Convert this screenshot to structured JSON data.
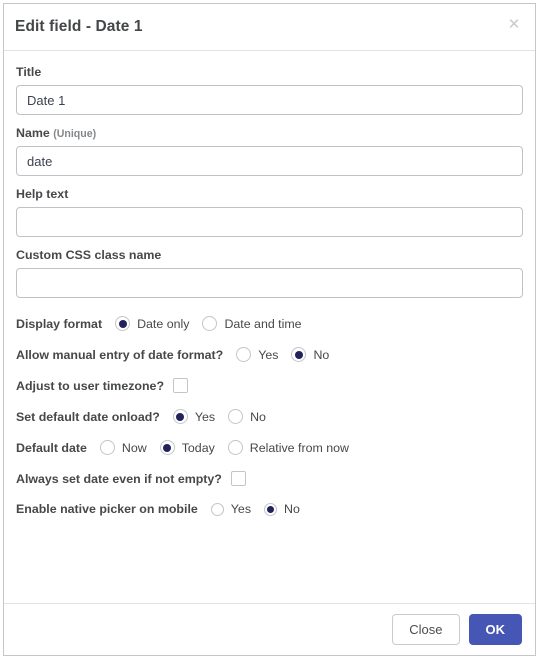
{
  "dialog": {
    "title": "Edit field - Date 1",
    "close_icon": "close-icon"
  },
  "fields": {
    "title": {
      "label": "Title",
      "value": "Date 1",
      "placeholder": ""
    },
    "name": {
      "label": "Name",
      "label_suffix": "(Unique)",
      "value": "date",
      "placeholder": ""
    },
    "help_text": {
      "label": "Help text",
      "value": "",
      "placeholder": ""
    },
    "custom_css": {
      "label": "Custom CSS class name",
      "value": "",
      "placeholder": ""
    }
  },
  "options": {
    "display_format": {
      "label": "Display format",
      "choices": [
        {
          "label": "Date only",
          "selected": true
        },
        {
          "label": "Date and time",
          "selected": false
        }
      ]
    },
    "allow_manual_entry": {
      "label": "Allow manual entry of date format?",
      "choices": [
        {
          "label": "Yes",
          "selected": false
        },
        {
          "label": "No",
          "selected": true
        }
      ]
    },
    "adjust_timezone": {
      "label": "Adjust to user timezone?",
      "checked": false
    },
    "set_default_onload": {
      "label": "Set default date onload?",
      "choices": [
        {
          "label": "Yes",
          "selected": true
        },
        {
          "label": "No",
          "selected": false
        }
      ]
    },
    "default_date": {
      "label": "Default date",
      "choices": [
        {
          "label": "Now",
          "selected": false
        },
        {
          "label": "Today",
          "selected": true
        },
        {
          "label": "Relative from now",
          "selected": false
        }
      ]
    },
    "always_set_date": {
      "label": "Always set date even if not empty?",
      "checked": false
    },
    "native_picker": {
      "label": "Enable native picker on mobile",
      "choices": [
        {
          "label": "Yes",
          "selected": false
        },
        {
          "label": "No",
          "selected": true
        }
      ]
    }
  },
  "footer": {
    "close_label": "Close",
    "ok_label": "OK"
  },
  "colors": {
    "primary": "#4656b4",
    "radio_selected": "#23235c",
    "border": "#bfc1c4",
    "text": "#46484a"
  }
}
